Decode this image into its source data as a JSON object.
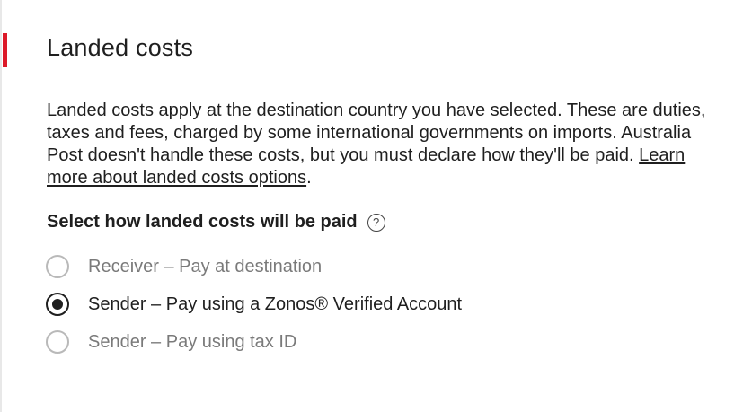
{
  "section": {
    "title": "Landed costs",
    "accent_color": "#dc1928",
    "description_text": "Landed costs apply at the destination country you have selected. These are duties, taxes and fees, charged by some international governments on imports. Australia Post doesn't handle these costs, but you must declare how they'll be paid. ",
    "learn_more_link": "Learn more about landed costs options",
    "description_end": "."
  },
  "question": {
    "label": "Select how landed costs will be paid",
    "help_icon": "question-circle-icon",
    "help_glyph": "?"
  },
  "options": [
    {
      "label": "Receiver – Pay at destination",
      "selected": false
    },
    {
      "label": "Sender – Pay using a Zonos® Verified Account",
      "selected": true
    },
    {
      "label": "Sender – Pay using tax ID",
      "selected": false
    }
  ]
}
